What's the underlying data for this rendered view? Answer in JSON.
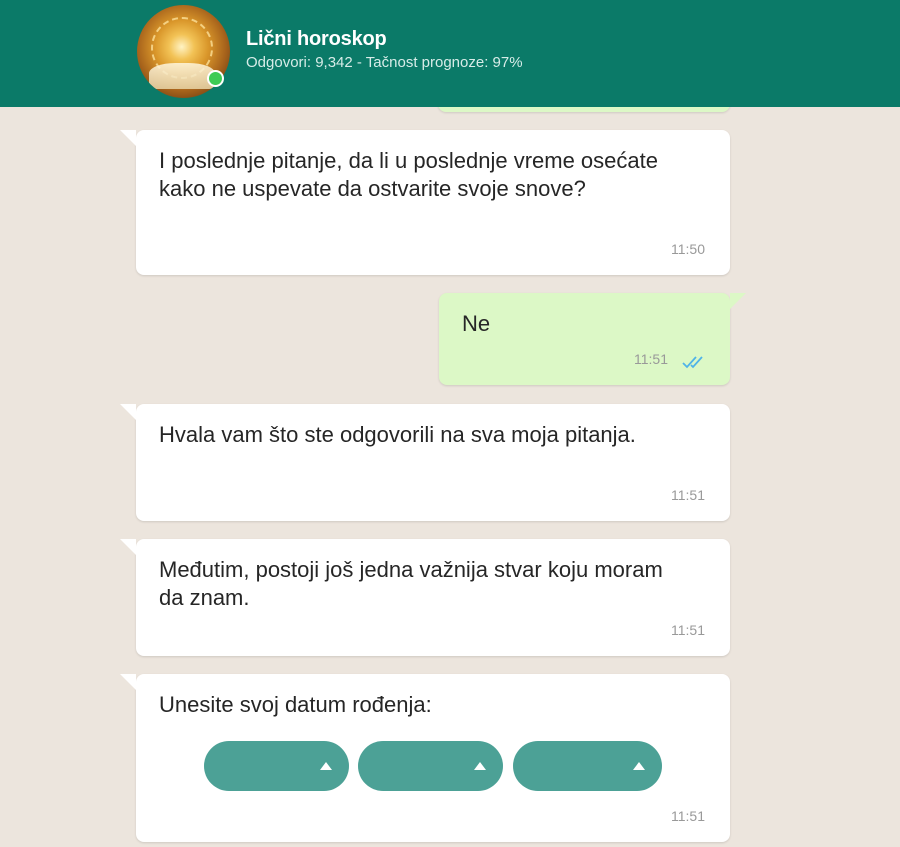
{
  "header": {
    "title": "Lični horoskop",
    "subtitle": "Odgovori: 9,342 - Tačnost prognoze: 97%"
  },
  "messages": [
    {
      "direction": "in",
      "text": "I poslednje pitanje, da li u poslednje vreme osećate kako ne uspevate da ostvarite svoje snove?",
      "time": "11:50"
    },
    {
      "direction": "out",
      "text": "Ne",
      "time": "11:51",
      "status": "double-check-read"
    },
    {
      "direction": "in",
      "text": "Hvala vam što ste odgovorili na sva moja pitanja.",
      "time": "11:51"
    },
    {
      "direction": "in",
      "text": "Međutim, postoji još jedna važnija stvar koju moram da znam.",
      "time": "11:51"
    },
    {
      "direction": "in",
      "text": "Unesite svoj datum rođenja:",
      "time": "11:51"
    }
  ],
  "birthdate_selects": [
    {
      "name": "day",
      "value": ""
    },
    {
      "name": "month",
      "value": ""
    },
    {
      "name": "year",
      "value": ""
    }
  ],
  "colors": {
    "header": "#0b7a68",
    "background": "#ece5dd",
    "incoming_bubble": "#ffffff",
    "outgoing_bubble": "#dcf8c6",
    "select": "#4ca196",
    "online": "#3ecb54",
    "read_ticks": "#4fb3e8"
  }
}
